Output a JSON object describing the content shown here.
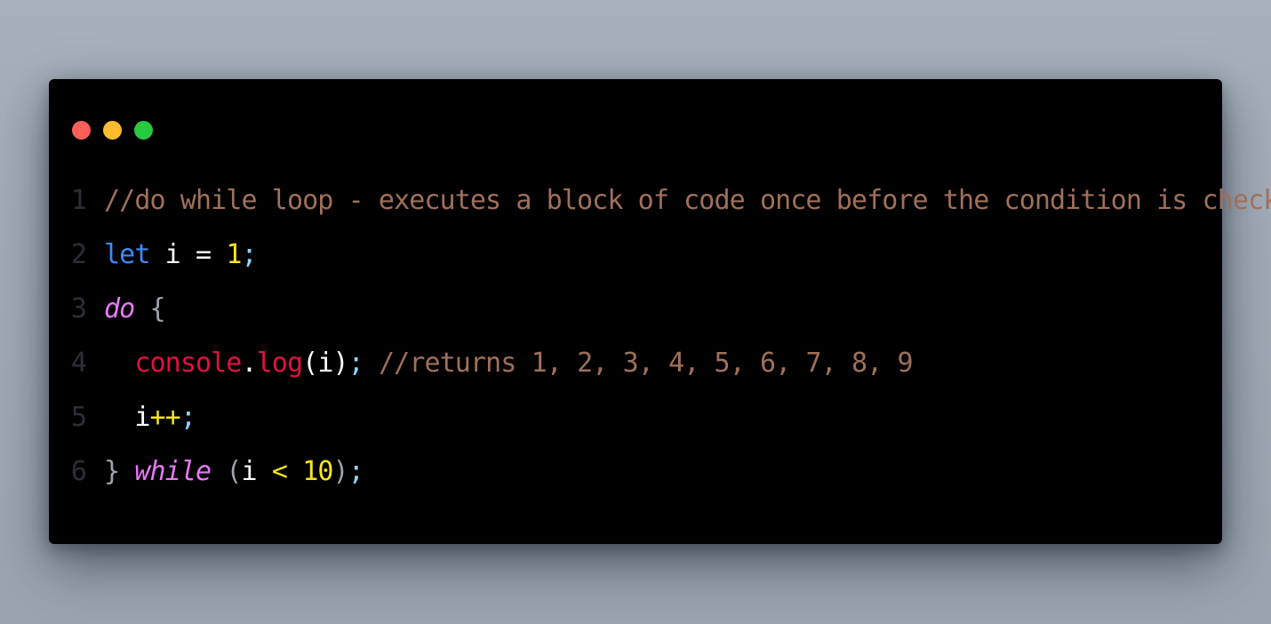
{
  "window": {
    "traffic_lights": [
      {
        "name": "close",
        "color": "#ff5f57"
      },
      {
        "name": "minimize",
        "color": "#febc2e"
      },
      {
        "name": "maximize",
        "color": "#28c840"
      }
    ]
  },
  "colors": {
    "comment": "#a0705a",
    "keyword_let": "#3d8bfd",
    "keyword_flow": "#e879f9",
    "identifier": "#ffffff",
    "number": "#f5e51b",
    "punct": "#8fd3ff",
    "brace": "#9ca3af",
    "function": "#e0123f",
    "operator": "#f5e51b",
    "line_number": "#2c2f36"
  },
  "code": {
    "lines": [
      {
        "number": "1",
        "tokens": [
          {
            "text": "//do while loop - executes a block of code once before the condition is checked",
            "type": "comment"
          }
        ]
      },
      {
        "number": "2",
        "tokens": [
          {
            "text": "let",
            "type": "keyword_let"
          },
          {
            "text": " i ",
            "type": "identifier"
          },
          {
            "text": "=",
            "type": "identifier"
          },
          {
            "text": " ",
            "type": "identifier"
          },
          {
            "text": "1",
            "type": "number"
          },
          {
            "text": ";",
            "type": "punct"
          }
        ]
      },
      {
        "number": "3",
        "tokens": [
          {
            "text": "do",
            "type": "keyword_flow",
            "italic": true
          },
          {
            "text": " ",
            "type": "identifier"
          },
          {
            "text": "{",
            "type": "brace"
          }
        ]
      },
      {
        "number": "4",
        "tokens": [
          {
            "text": "  ",
            "type": "identifier"
          },
          {
            "text": "console",
            "type": "function"
          },
          {
            "text": ".",
            "type": "identifier"
          },
          {
            "text": "log",
            "type": "function"
          },
          {
            "text": "(",
            "type": "identifier"
          },
          {
            "text": "i",
            "type": "identifier"
          },
          {
            "text": ")",
            "type": "identifier"
          },
          {
            "text": ";",
            "type": "punct"
          },
          {
            "text": " ",
            "type": "identifier"
          },
          {
            "text": "//returns 1, 2, 3, 4, 5, 6, 7, 8, 9",
            "type": "comment"
          }
        ]
      },
      {
        "number": "5",
        "tokens": [
          {
            "text": "  ",
            "type": "identifier"
          },
          {
            "text": "i",
            "type": "identifier"
          },
          {
            "text": "++",
            "type": "operator"
          },
          {
            "text": ";",
            "type": "punct"
          }
        ]
      },
      {
        "number": "6",
        "tokens": [
          {
            "text": "}",
            "type": "brace"
          },
          {
            "text": " ",
            "type": "identifier"
          },
          {
            "text": "while",
            "type": "keyword_flow",
            "italic": true
          },
          {
            "text": " ",
            "type": "identifier"
          },
          {
            "text": "(",
            "type": "brace"
          },
          {
            "text": "i",
            "type": "identifier"
          },
          {
            "text": " ",
            "type": "identifier"
          },
          {
            "text": "<",
            "type": "operator"
          },
          {
            "text": " ",
            "type": "identifier"
          },
          {
            "text": "10",
            "type": "number"
          },
          {
            "text": ")",
            "type": "brace"
          },
          {
            "text": ";",
            "type": "punct"
          }
        ]
      }
    ]
  }
}
